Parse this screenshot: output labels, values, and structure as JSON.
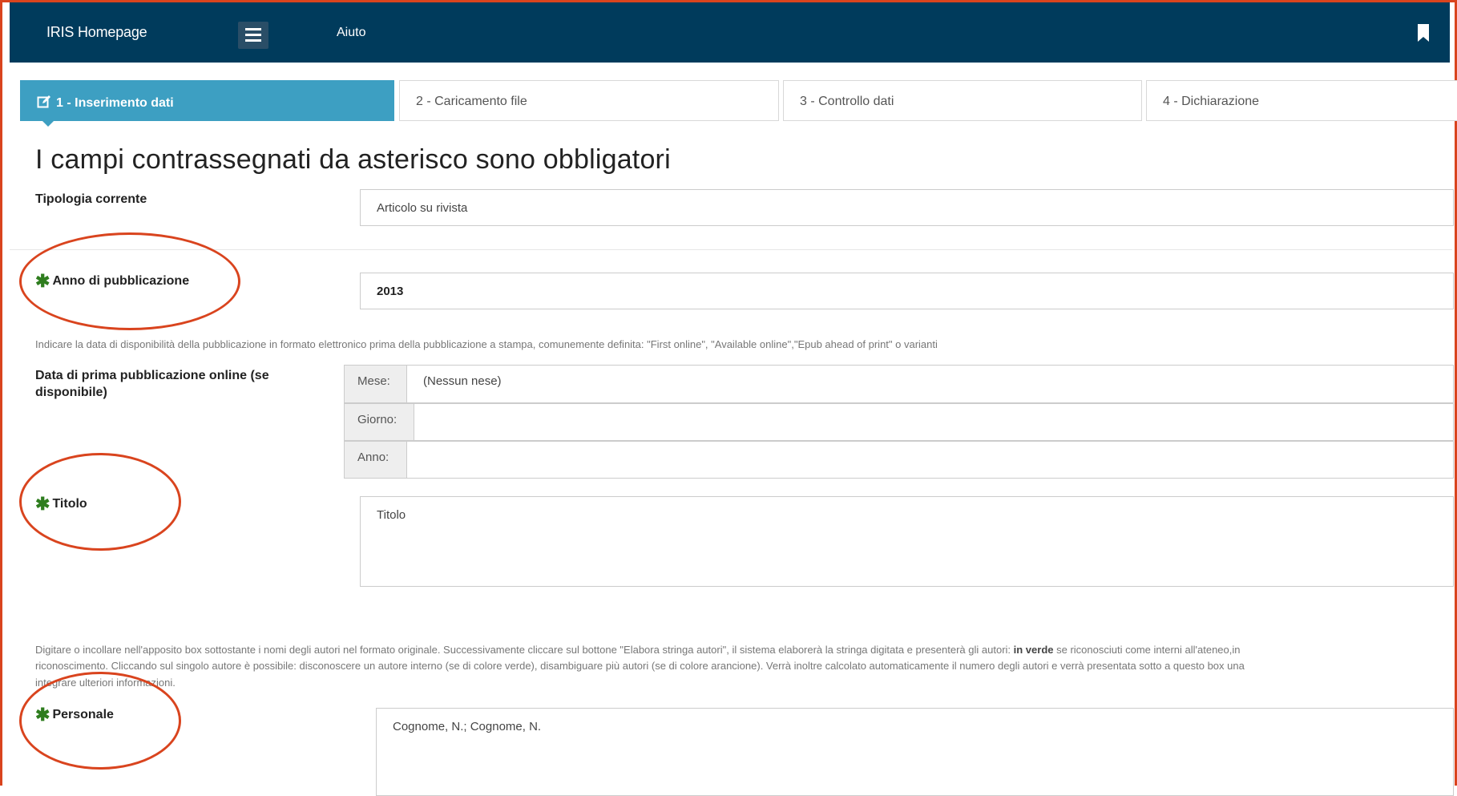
{
  "navbar": {
    "brand": "IRIS Homepage",
    "help": "Aiuto",
    "menu_icon": "hamburger-icon",
    "bookmark_icon": "bookmark-icon"
  },
  "steps": [
    {
      "label": "1 - Inserimento dati",
      "active": true,
      "icon": "edit-icon"
    },
    {
      "label": "2 - Caricamento file"
    },
    {
      "label": "3 - Controllo dati"
    },
    {
      "label": "4 - Dichiarazione"
    }
  ],
  "title": "I campi contrassegnati da asterisco sono obbligatori",
  "tipologia": {
    "label": "Tipologia corrente",
    "value": "Articolo su rivista"
  },
  "anno": {
    "label": "Anno di pubblicazione",
    "value": "2013"
  },
  "online_help": "Indicare la data di disponibilità della pubblicazione in formato elettronico prima della pubblicazione a stampa, comunemente definita: \"First online\", \"Available online\",\"Epub ahead of print\" o varianti",
  "online_date": {
    "label_line1": "Data di prima pubblicazione online (se",
    "label_line2": "disponibile)",
    "month_label": "Mese:",
    "month_value": "(Nessun nese)",
    "day_label": "Giorno:",
    "year_label": "Anno:"
  },
  "titolo": {
    "label": "Titolo",
    "placeholder": "Titolo"
  },
  "authors_help": {
    "line1_a": "Digitare o incollare nell'apposito box sottostante i nomi degli autori nel formato originale. Successivamente cliccare sul bottone \"Elabora stringa autori\", il sistema elaborerà la stringa digitata e presenterà gli autori: ",
    "line1_b": "in verde",
    "line1_c": " se riconosciuti come interni all'ateneo,in ",
    "line2": "riconoscimento. Cliccando sul singolo autore è possibile: disconoscere un autore interno (se di colore verde), disambiguare più autori (se di colore arancione). Verrà inoltre calcolato automaticamente il numero degli autori e verrà presentata sotto a questo box una",
    "line3": "integrare ulteriori informazioni."
  },
  "personale": {
    "label": "Personale",
    "placeholder": "Cognome, N.; Cognome, N."
  },
  "colors": {
    "navbar": "#003b5c",
    "active_step": "#3d9fc2",
    "required_star": "#2e7d1e",
    "annotation": "#d9441e"
  }
}
